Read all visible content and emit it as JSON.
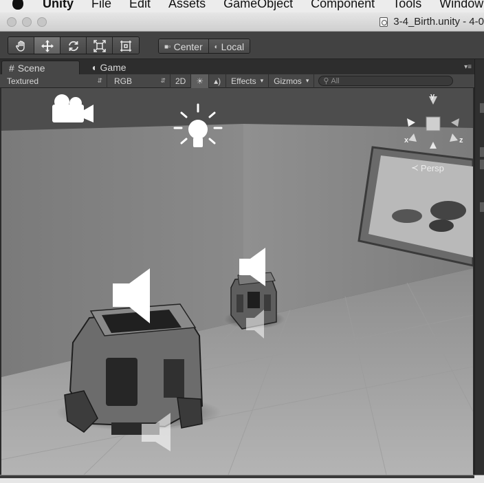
{
  "menubar": {
    "app_name": "Unity",
    "items": [
      "File",
      "Edit",
      "Assets",
      "GameObject",
      "Component",
      "Tools",
      "Window"
    ]
  },
  "window": {
    "title": "3-4_Birth.unity - 4-0"
  },
  "toolbar": {
    "tools": [
      {
        "name": "hand-tool",
        "icon": "hand-icon"
      },
      {
        "name": "move-tool",
        "icon": "move-arrows-icon",
        "active": true
      },
      {
        "name": "rotate-tool",
        "icon": "rotate-icon"
      },
      {
        "name": "scale-tool",
        "icon": "scale-icon"
      },
      {
        "name": "rect-tool",
        "icon": "rect-icon"
      }
    ],
    "pivot_mode": "Center",
    "pivot_rotation": "Local"
  },
  "tabs": [
    {
      "label": "Scene",
      "icon": "grid-icon",
      "active": true
    },
    {
      "label": "Game",
      "icon": "pacman-icon",
      "active": false
    }
  ],
  "scene_controls": {
    "draw_mode": "Textured",
    "render_mode": "RGB",
    "toggle_2d": "2D",
    "effects_label": "Effects",
    "gizmos_label": "Gizmos",
    "search_placeholder": "All"
  },
  "viewport": {
    "projection_label": "Persp",
    "axes": {
      "x": "x",
      "y": "y",
      "z": "z"
    },
    "scene_icons": [
      "camera-gizmo-icon",
      "light-gizmo-icon",
      "audio-source-icon"
    ]
  },
  "colors": {
    "toolbar_bg": "#424242",
    "viewport_bg": "#4c4c4c",
    "tab_active": "#474747"
  }
}
